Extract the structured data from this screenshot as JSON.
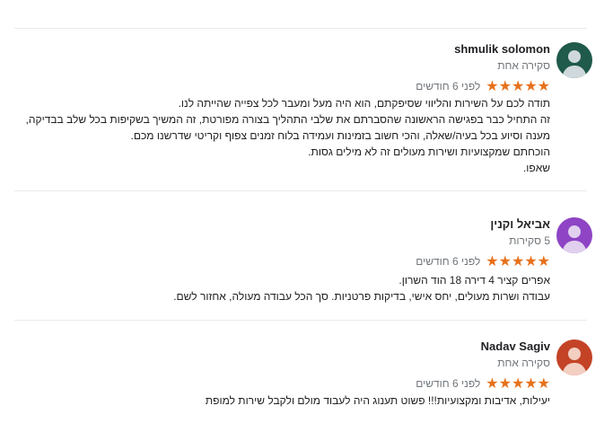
{
  "reviews": [
    {
      "name": "shmulik solomon",
      "subtitle": "סקירה אחת",
      "stars": 5,
      "time": "לפני 6 חודשים",
      "avatar_color": "#1f5a4b",
      "lines": [
        "תודה לכם על השירות והליווי שסיפקתם, הוא היה מעל ומעבר לכל צפייה שהייתה לנו.",
        "זה התחיל כבר בפגישה הראשונה שהסברתם את שלבי התהליך בצורה מפורטת, זה המשיך בשקיפות בכל שלב בבדיקה,",
        "מענה וסיוע בכל בעיה/שאלה, והכי חשוב בזמינות ועמידה בלוח זמנים צפוף וקריטי שדרשנו מכם.",
        "הוכחתם שמקצועיות ושירות מעולים זה לא מילים גסות.",
        "שאפו."
      ]
    },
    {
      "name": "אביאל וקנין",
      "subtitle": "5 סקירות",
      "stars": 5,
      "time": "לפני 6 חודשים",
      "avatar_color": "#8e44c4",
      "lines": [
        "אפרים קציר 4 דירה 18 הוד השרון.",
        "עבודה ושרות מעולים, יחס אישי, בדיקות פרטניות. סך הכל עבודה מעולה, אחזור לשם."
      ]
    },
    {
      "name": "Nadav Sagiv",
      "subtitle": "סקירה אחת",
      "stars": 5,
      "time": "לפני 6 חודשים",
      "avatar_color": "#c44327",
      "lines": [
        "יעילות, אדיבות ומקצועיות!!! פשוט תענוג היה לעבוד מולם ולקבל שירות למופת"
      ]
    }
  ],
  "colors": {
    "star": "#e7711b",
    "divider": "#e8eaed",
    "muted_text": "#70757a"
  }
}
